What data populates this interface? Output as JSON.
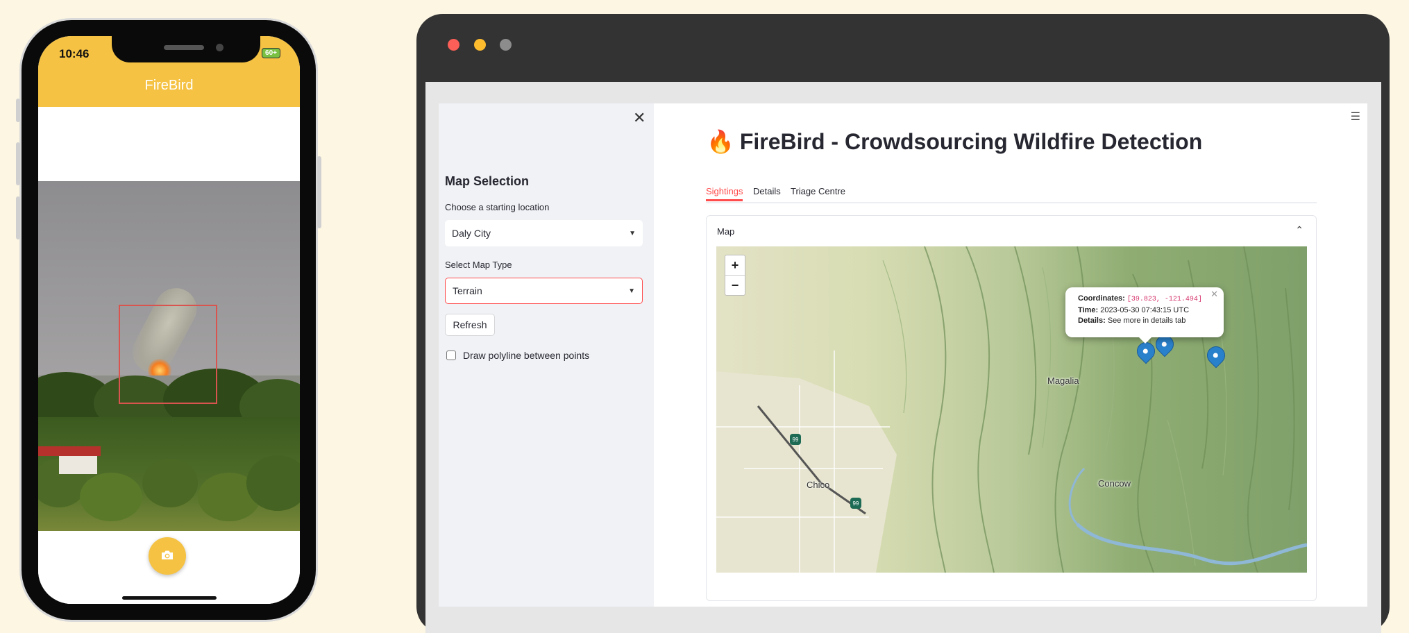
{
  "phone": {
    "status_time": "10:46",
    "battery": "60+",
    "title": "FireBird",
    "camera_icon": "camera-icon"
  },
  "browser": {
    "window_dots": [
      "#fc5f57",
      "#fdbc2e",
      "#8c8c8c"
    ],
    "sidebar": {
      "heading": "Map Selection",
      "location_label": "Choose a starting location",
      "location_value": "Daly City",
      "map_type_label": "Select Map Type",
      "map_type_value": "Terrain",
      "refresh_label": "Refresh",
      "polyline_label": "Draw polyline between points"
    },
    "main": {
      "title_icon": "🔥",
      "title": "FireBird - Crowdsourcing Wildfire Detection",
      "tabs": [
        "Sightings",
        "Details",
        "Triage Centre"
      ],
      "active_tab": "Sightings",
      "expander_label": "Map",
      "map": {
        "zoom_in": "+",
        "zoom_out": "−",
        "places": [
          "Magalia",
          "Chico",
          "Concow"
        ],
        "highway_shield": "99",
        "popup": {
          "coords_label": "Coordinates:",
          "coords_value": "[39.823, -121.494]",
          "time_label": "Time:",
          "time_value": "2023-05-30 07:43:15 UTC",
          "details_label": "Details:",
          "details_value": "See more in details tab"
        }
      }
    }
  },
  "colors": {
    "accent": "#ff4b4b",
    "phone_header": "#f5c243",
    "marker": "#2a81cb",
    "page_bg": "#fdf6e3"
  }
}
